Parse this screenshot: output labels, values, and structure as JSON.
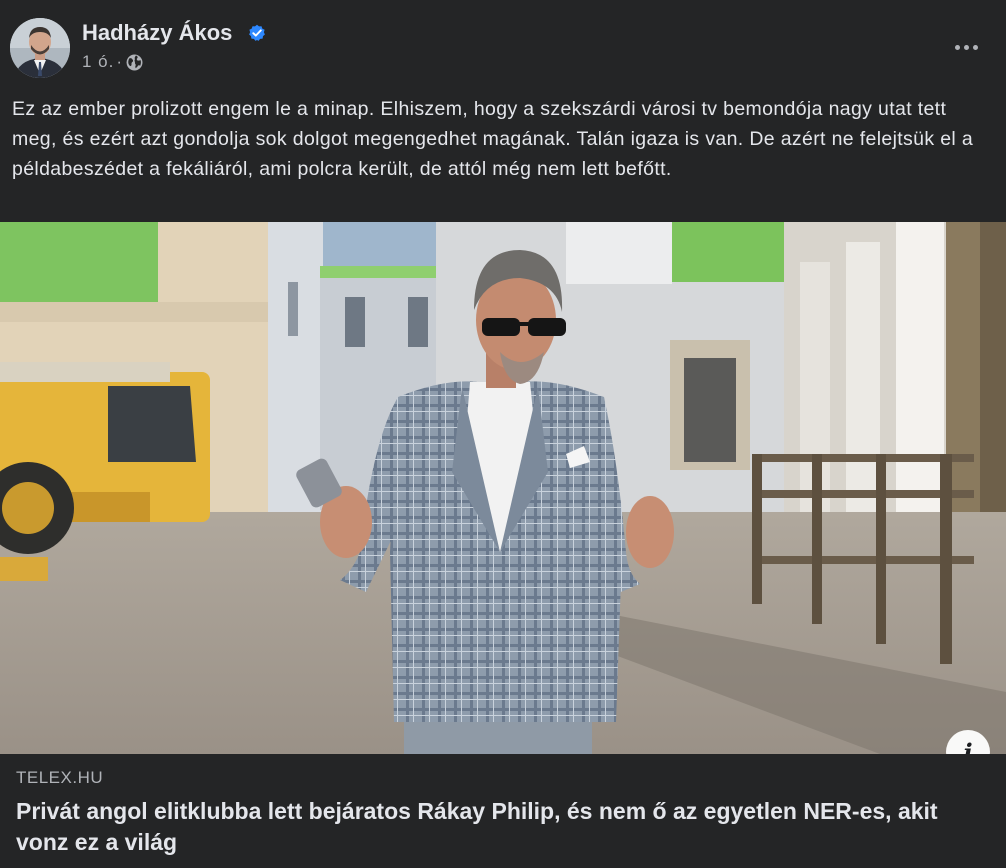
{
  "post": {
    "author": "Hadházy Ákos",
    "time": "1 ó.",
    "separator": "·",
    "text": "Ez az ember prolizott engem le a minap. Elhiszem, hogy a szekszárdi városi tv bemondója nagy utat tett meg, és ezért azt gondolja sok dolgot megengedhet magának. Talán igaza is van. De azért ne felejtsük el a példabeszédet a fekáliáról, ami polcra került, de attól még nem lett befőtt.",
    "image_info_label": "i"
  },
  "link_preview": {
    "domain": "TELEX.HU",
    "title": "Privát angol elitklubba lett bejáratos Rákay Philip, és nem ő az egyetlen NER-es, akit vonz ez a világ"
  },
  "icons": {
    "verified": "verified-badge-icon",
    "audience": "globe-icon",
    "more": "more-options-icon",
    "info": "info-icon"
  },
  "colors": {
    "background": "#242526",
    "text_primary": "#e4e6eb",
    "text_secondary": "#b0b3b8",
    "verified_blue": "#2d88ff"
  }
}
